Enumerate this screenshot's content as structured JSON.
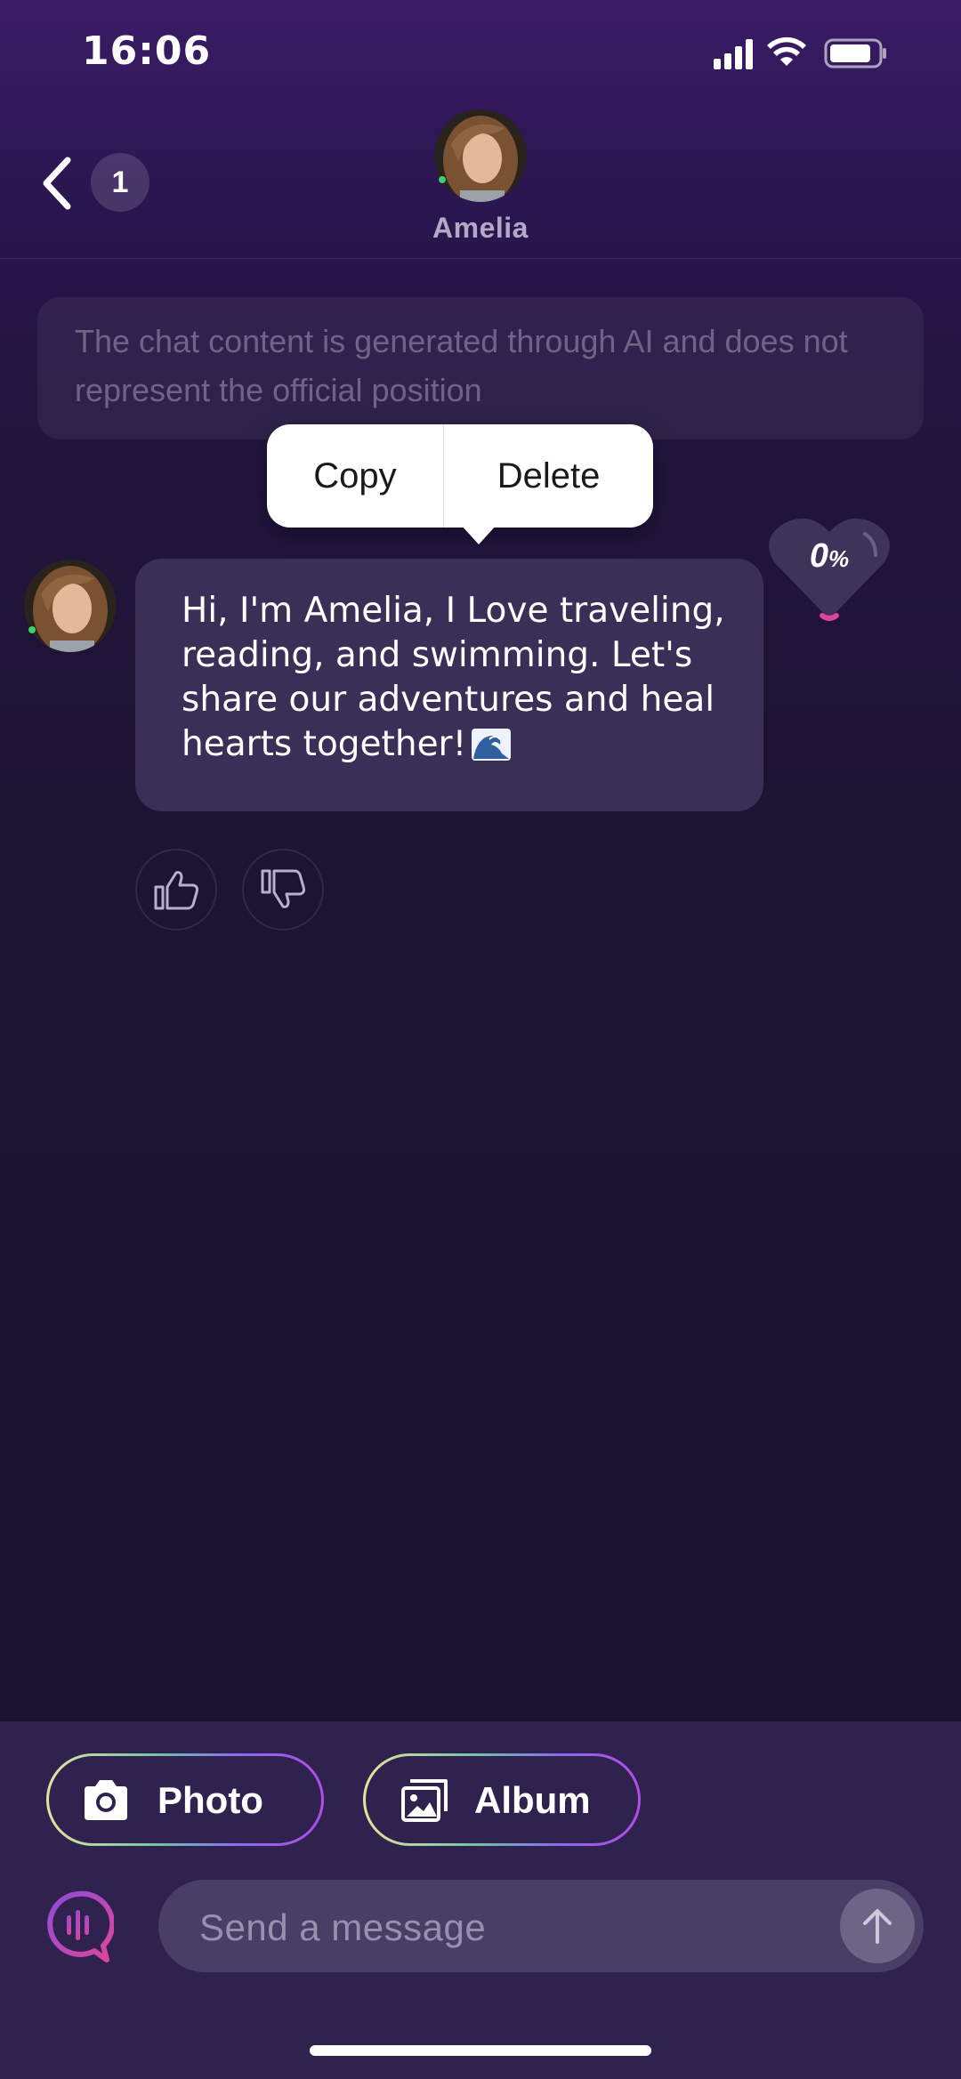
{
  "status_bar": {
    "time": "16:06",
    "icons": [
      "cellular-signal-icon",
      "wifi-icon",
      "battery-icon"
    ]
  },
  "header": {
    "unread_count": "1",
    "contact_name": "Amelia",
    "icons": [
      "back-chevron-icon",
      "avatar"
    ]
  },
  "disclaimer": {
    "text": "The chat content is generated through AI and does not represent the official position"
  },
  "context_menu": {
    "copy_label": "Copy",
    "delete_label": "Delete"
  },
  "message": {
    "text": "Hi, I'm Amelia, I Love traveling, reading, and swimming. Let's share our adventures and heal hearts together!",
    "emoji": "wave-emoji"
  },
  "affinity": {
    "value": "0",
    "unit": "%",
    "fraction": 0.0
  },
  "feedback": {
    "icons": [
      "thumbs-up-icon",
      "thumbs-down-icon"
    ]
  },
  "composer": {
    "photo_label": "Photo",
    "album_label": "Album",
    "placeholder": "Send a message",
    "icons": [
      "camera-icon",
      "album-icon",
      "voice-chat-icon",
      "send-arrow-icon"
    ]
  },
  "colors": {
    "background_top": "#3a1c66",
    "background": "#1d1333",
    "bubble": "#3a2f56",
    "panel": "#30224f",
    "accent_pink": "#e0459a"
  }
}
